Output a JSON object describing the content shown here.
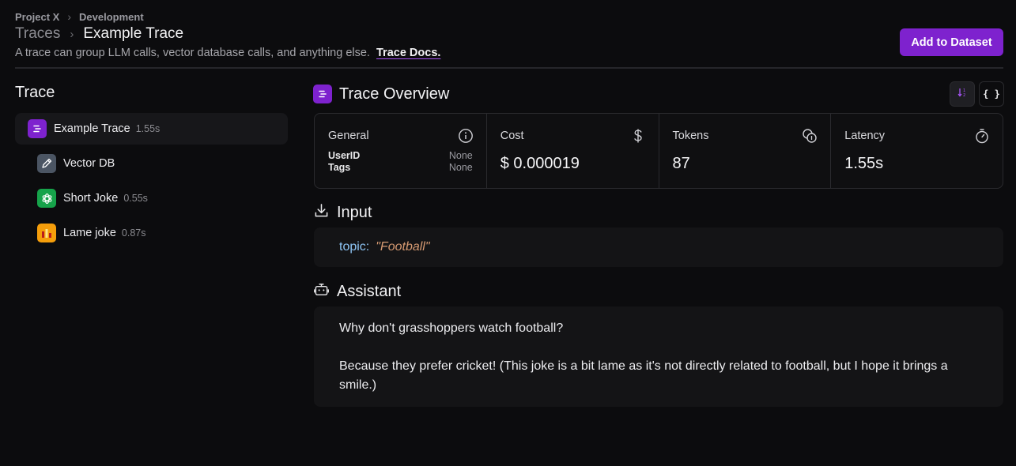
{
  "breadcrumb": {
    "project": "Project X",
    "environment": "Development"
  },
  "title": {
    "parent": "Traces",
    "current": "Example Trace"
  },
  "subtitle": {
    "text": "A trace can group LLM calls, vector database calls, and anything else.",
    "link": "Trace Docs."
  },
  "actions": {
    "add_to_dataset": "Add to Dataset"
  },
  "sidebar": {
    "title": "Trace",
    "root": {
      "label": "Example Trace",
      "duration": "1.55s",
      "icon": "trace-icon"
    },
    "children": [
      {
        "label": "Vector DB",
        "duration": "",
        "icon": "pencil-icon"
      },
      {
        "label": "Short Joke",
        "duration": "0.55s",
        "icon": "openai-icon"
      },
      {
        "label": "Lame joke",
        "duration": "0.87s",
        "icon": "custom-chain-icon"
      }
    ]
  },
  "overview": {
    "title": "Trace Overview",
    "general": {
      "label": "General",
      "rows": [
        {
          "key": "UserID",
          "value": "None"
        },
        {
          "key": "Tags",
          "value": "None"
        }
      ]
    },
    "cost": {
      "label": "Cost",
      "value": "$ 0.000019"
    },
    "tokens": {
      "label": "Tokens",
      "value": "87"
    },
    "latency": {
      "label": "Latency",
      "value": "1.55s"
    }
  },
  "input": {
    "title": "Input",
    "key": "topic:",
    "value": "\"Football\""
  },
  "assistant": {
    "title": "Assistant",
    "paragraphs": [
      "Why don't grasshoppers watch football?",
      "Because they prefer cricket! (This joke is a bit lame as it's not directly related to football, but I hope it brings a smile.)"
    ]
  },
  "colors": {
    "accent": "#7e22ce",
    "background": "#0c0c0e",
    "openai": "#16a34a",
    "lame": "#f59e0b"
  }
}
